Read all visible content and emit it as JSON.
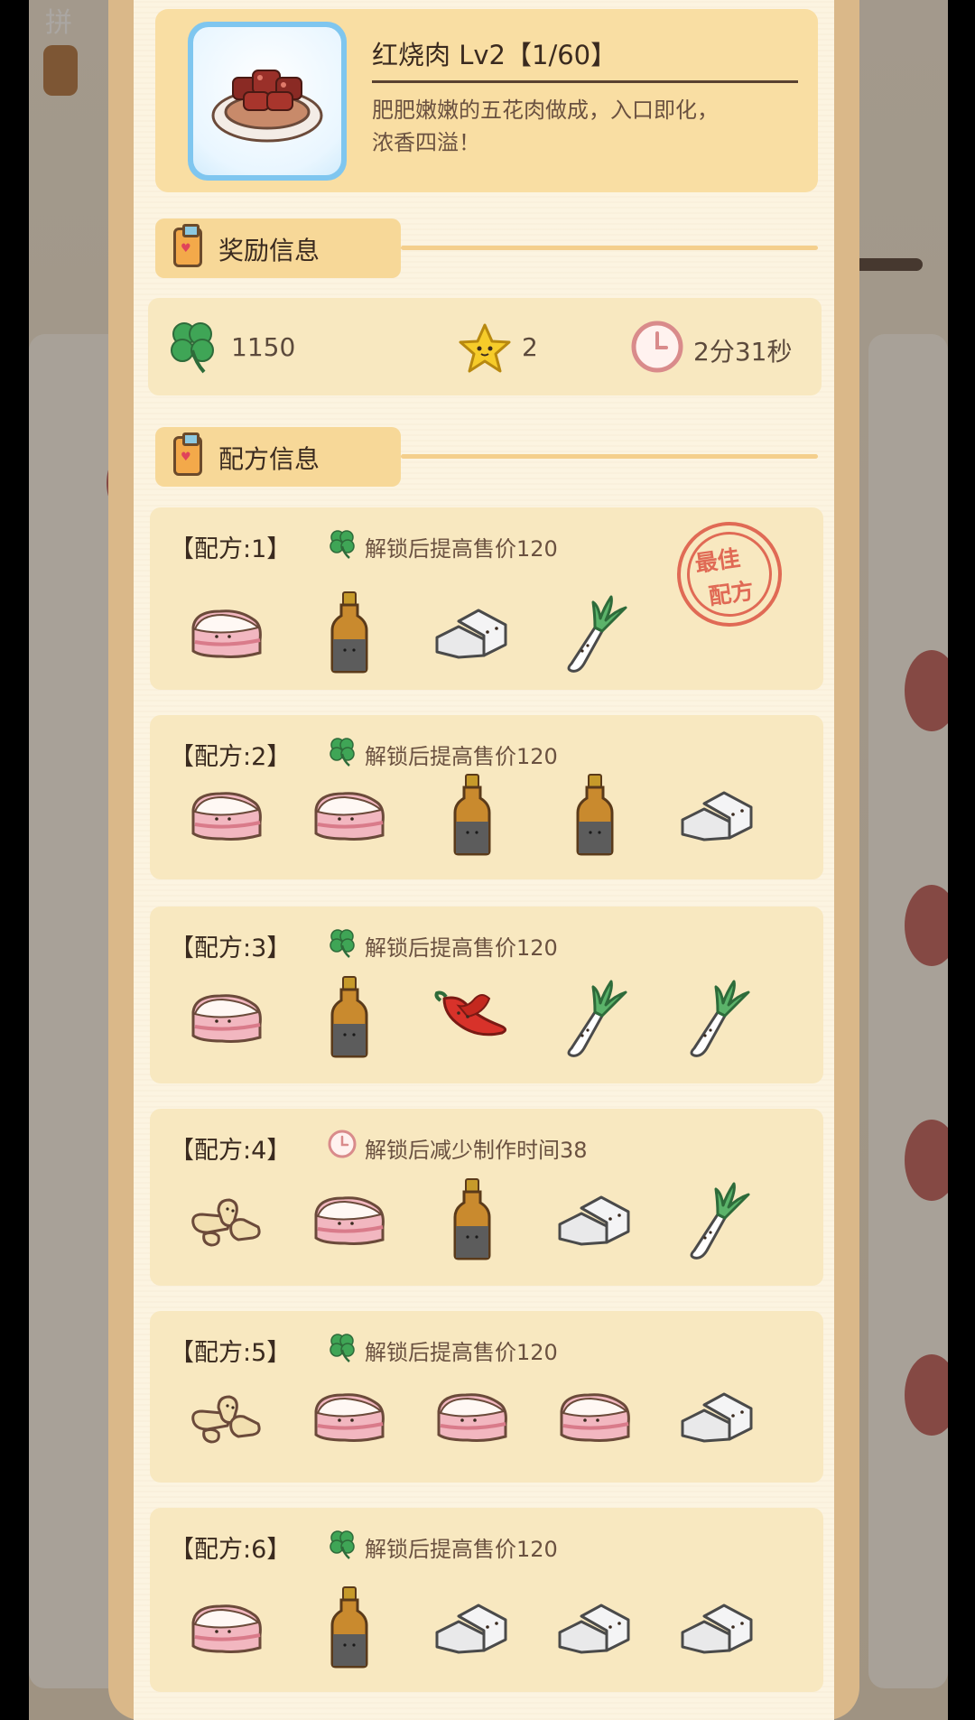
{
  "colors": {
    "accent": "#f9dea3",
    "panel": "#fcf4e1",
    "card": "#f8e8c0",
    "stamp": "#e06a55",
    "text": "#3a2a1f"
  },
  "background": {
    "corner_text": "拼"
  },
  "dish": {
    "name": "红烧肉 Lv2【1/60】",
    "desc_line1": "肥肥嫩嫩的五花肉做成，入口即化，",
    "desc_line2": "浓香四溢！",
    "image": "braised-pork-dish-icon"
  },
  "sections": {
    "reward_label": "奖励信息",
    "recipe_label": "配方信息"
  },
  "rewards": {
    "clover": "1150",
    "star": "2",
    "time": "2分31秒"
  },
  "stamp": {
    "line1": "最佳",
    "line2": "配方"
  },
  "recipes": [
    {
      "title": "【配方:1】",
      "effect_icon": "clover-icon",
      "effect": "解锁后提高售价120",
      "best": true,
      "ingredients": [
        "pork-belly-icon",
        "soy-sauce-bottle-icon",
        "tofu-icon",
        "scallion-icon"
      ]
    },
    {
      "title": "【配方:2】",
      "effect_icon": "clover-icon",
      "effect": "解锁后提高售价120",
      "ingredients": [
        "pork-belly-icon",
        "pork-belly-icon",
        "soy-sauce-bottle-icon",
        "soy-sauce-bottle-icon",
        "tofu-icon"
      ]
    },
    {
      "title": "【配方:3】",
      "effect_icon": "clover-icon",
      "effect": "解锁后提高售价120",
      "ingredients": [
        "pork-belly-icon",
        "soy-sauce-bottle-icon",
        "chili-pepper-icon",
        "scallion-icon",
        "scallion-icon"
      ]
    },
    {
      "title": "【配方:4】",
      "effect_icon": "clock-icon",
      "effect": "解锁后减少制作时间38",
      "ingredients": [
        "ginger-icon",
        "pork-belly-icon",
        "soy-sauce-bottle-icon",
        "tofu-icon",
        "scallion-icon"
      ]
    },
    {
      "title": "【配方:5】",
      "effect_icon": "clover-icon",
      "effect": "解锁后提高售价120",
      "ingredients": [
        "ginger-icon",
        "pork-belly-icon",
        "pork-belly-icon",
        "pork-belly-icon",
        "tofu-icon"
      ]
    },
    {
      "title": "【配方:6】",
      "effect_icon": "clover-icon",
      "effect": "解锁后提高售价120",
      "ingredients": [
        "pork-belly-icon",
        "soy-sauce-bottle-icon",
        "tofu-icon",
        "tofu-icon",
        "tofu-icon"
      ]
    }
  ]
}
